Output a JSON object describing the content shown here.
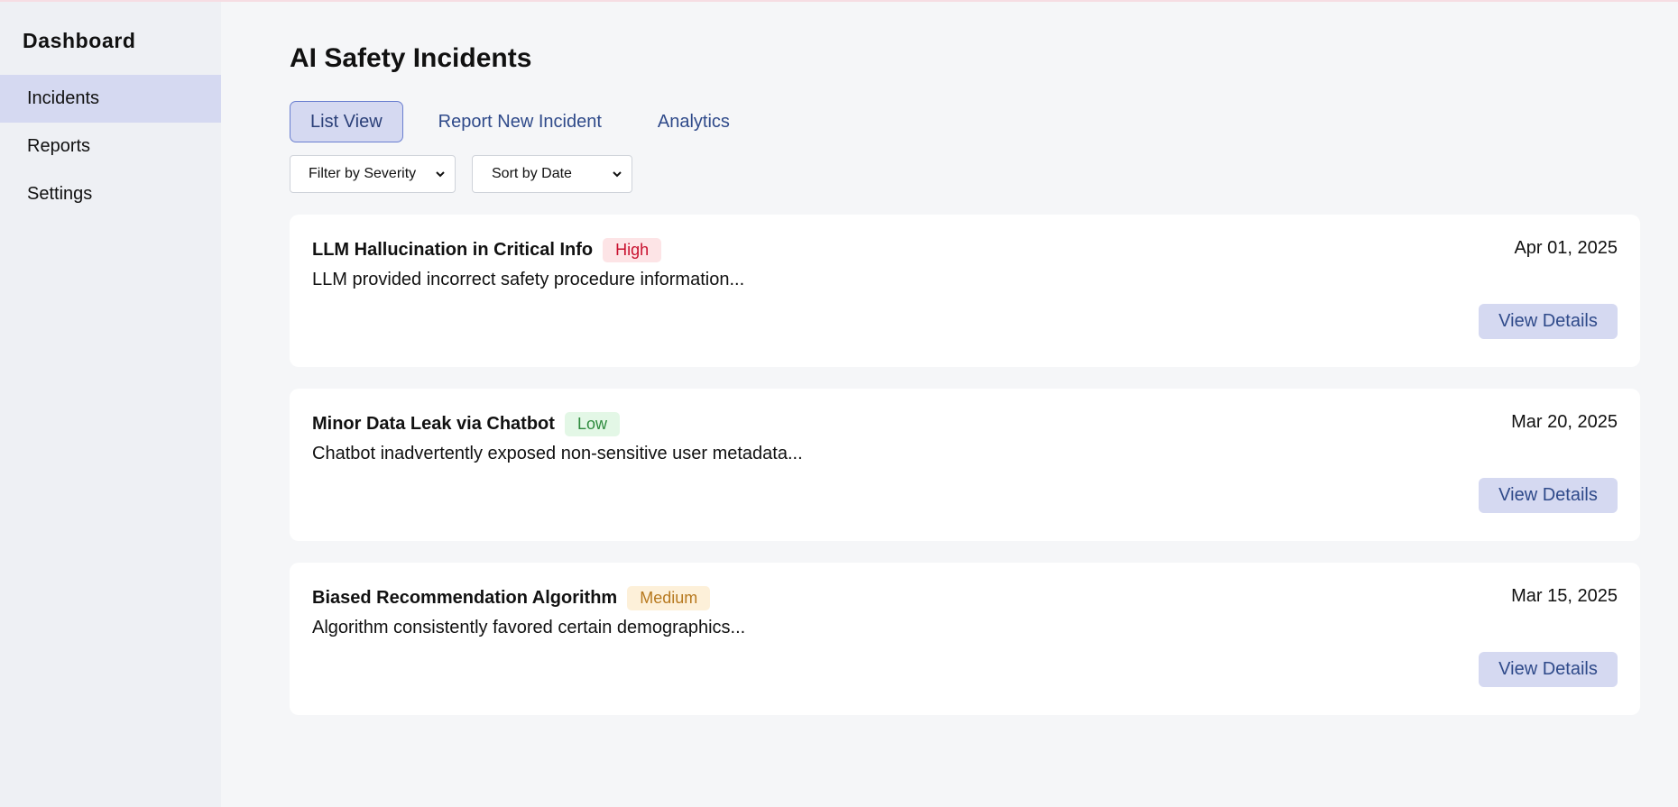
{
  "sidebar": {
    "title": "Dashboard",
    "items": [
      {
        "label": "Incidents",
        "active": true
      },
      {
        "label": "Reports",
        "active": false
      },
      {
        "label": "Settings",
        "active": false
      }
    ]
  },
  "main": {
    "title": "AI Safety Incidents",
    "tabs": [
      {
        "label": "List View",
        "active": true
      },
      {
        "label": "Report New Incident",
        "active": false
      },
      {
        "label": "Analytics",
        "active": false
      }
    ],
    "filters": {
      "severity": "Filter by Severity",
      "sort": "Sort by Date"
    },
    "incidents": [
      {
        "title": "LLM Hallucination in Critical Info",
        "severity": "High",
        "date": "Apr 01, 2025",
        "description": "LLM provided incorrect safety procedure information...",
        "button": "View Details"
      },
      {
        "title": "Minor Data Leak via Chatbot",
        "severity": "Low",
        "date": "Mar 20, 2025",
        "description": "Chatbot inadvertently exposed non-sensitive user metadata...",
        "button": "View Details"
      },
      {
        "title": "Biased Recommendation Algorithm",
        "severity": "Medium",
        "date": "Mar 15, 2025",
        "description": "Algorithm consistently favored certain demographics...",
        "button": "View Details"
      }
    ]
  },
  "colors": {
    "accent": "#d5d9f1",
    "link": "#2f4a8a",
    "high": "#c8102e",
    "low": "#2e8b3e",
    "medium": "#b7791f"
  },
  "icons": {
    "select_arrow": "chevron-down-icon"
  }
}
